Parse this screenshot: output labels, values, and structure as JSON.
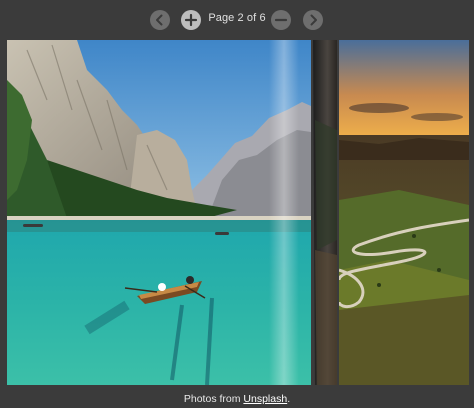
{
  "toolbar": {
    "prev_icon": "chevron-left-icon",
    "add_icon": "plus-icon",
    "remove_icon": "minus-icon",
    "next_icon": "chevron-right-icon",
    "page_label": "Page 2 of 6"
  },
  "viewer": {
    "left_photo": "mountain-lake-rowboat-photo",
    "right_photo": "sunset-valley-road-photo"
  },
  "caption": {
    "prefix": "Photos from ",
    "link": "Unsplash",
    "suffix": "."
  },
  "colors": {
    "background": "#3b3b3b",
    "button": "#6e6e6e",
    "button_active": "#bdbdbd",
    "text": "#e0e0e0"
  }
}
